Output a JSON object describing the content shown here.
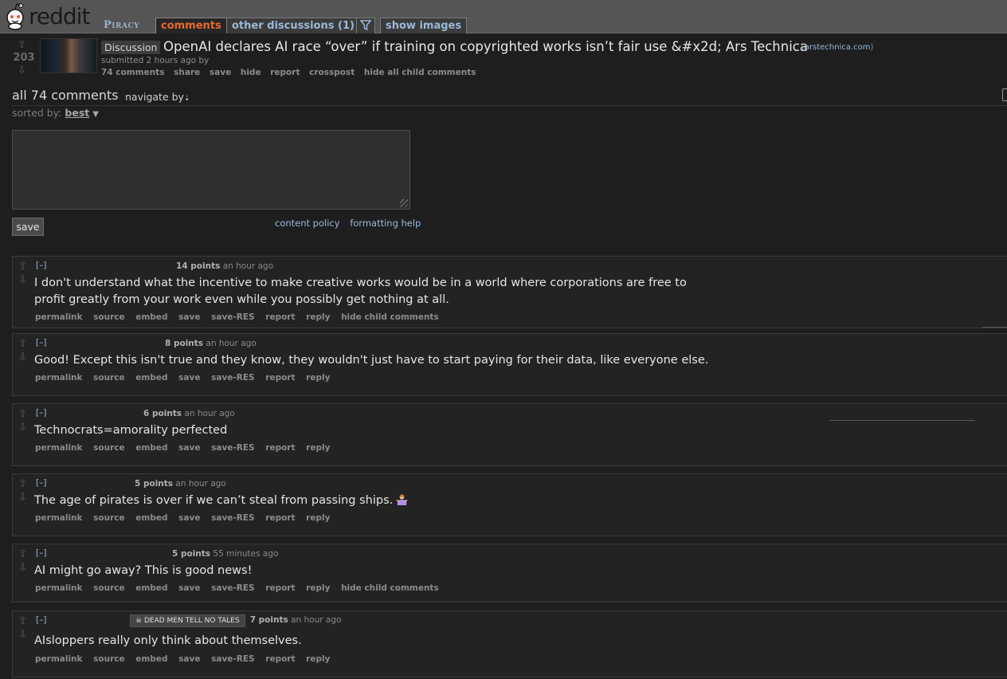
{
  "header": {
    "site_name": "reddit",
    "subreddit": "Piracy",
    "tabs": [
      "comments",
      "other discussions (1)",
      "show images"
    ]
  },
  "post": {
    "score": "203",
    "flair": "Discussion",
    "title": "OpenAI declares AI race “over” if training on copyrighted works isn’t fair use &#x2d; Ars Technica",
    "domain_open": "(",
    "domain": "arstechnica.com",
    "domain_close": ")",
    "tagline": "submitted 2 hours ago by",
    "buttons": [
      "74 comments",
      "share",
      "save",
      "hide",
      "report",
      "crosspost",
      "hide all child comments"
    ]
  },
  "comment_area": {
    "count_label": "all 74 comments",
    "navigate_label": "navigate by",
    "sorted_by_label": "sorted by:",
    "sort_value": "best",
    "save_label": "save",
    "content_policy": "content policy",
    "formatting_help": "formatting help"
  },
  "comments": [
    {
      "toggle": "[–]",
      "points": "14 points",
      "time": "an hour ago",
      "body": "I don't understand what the incentive to make creative works would be in a world where corporations are free to profit greatly from your work even while you possibly get nothing at all.",
      "buttons": [
        "permalink",
        "source",
        "embed",
        "save",
        "save-RES",
        "report",
        "reply",
        "hide child comments"
      ]
    },
    {
      "toggle": "[–]",
      "points": "8 points",
      "time": "an hour ago",
      "body": "Good! Except this isn't true and they know, they wouldn't just have to start paying for their data, like everyone else.",
      "buttons": [
        "permalink",
        "source",
        "embed",
        "save",
        "save-RES",
        "report",
        "reply"
      ]
    },
    {
      "toggle": "[–]",
      "points": "6 points",
      "time": "an hour ago",
      "body": "Technocrats=amorality perfected",
      "buttons": [
        "permalink",
        "source",
        "embed",
        "save",
        "save-RES",
        "report",
        "reply"
      ]
    },
    {
      "toggle": "[–]",
      "points": "5 points",
      "time": "an hour ago",
      "body": "The age of pirates is over if we can’t steal from passing ships.",
      "buttons": [
        "permalink",
        "source",
        "embed",
        "save",
        "save-RES",
        "report",
        "reply"
      ]
    },
    {
      "toggle": "[–]",
      "points": "5 points",
      "time": "55 minutes ago",
      "body": "AI might go away? This is good news!",
      "buttons": [
        "permalink",
        "source",
        "embed",
        "save",
        "save-RES",
        "report",
        "reply",
        "hide child comments"
      ]
    },
    {
      "toggle": "[–]",
      "user_flair": "DEAD MEN TELL NO TALES",
      "points": "7 points",
      "time": "an hour ago",
      "body": "AIsloppers really only think about themselves.",
      "buttons": [
        "permalink",
        "source",
        "embed",
        "save",
        "save-RES",
        "report",
        "reply"
      ]
    }
  ],
  "icons": {
    "upvote": "up-arrow-icon",
    "downvote": "down-arrow-icon",
    "filter": "filter-icon",
    "logo": "reddit-alien-icon",
    "emoji": "person-shrugging-icon",
    "flair": "skull-crossbones-icon"
  },
  "colors": {
    "background": "#1e1e1e",
    "header": "#555555",
    "active_tab": "#e86a2e",
    "link": "#9cb8d8"
  }
}
